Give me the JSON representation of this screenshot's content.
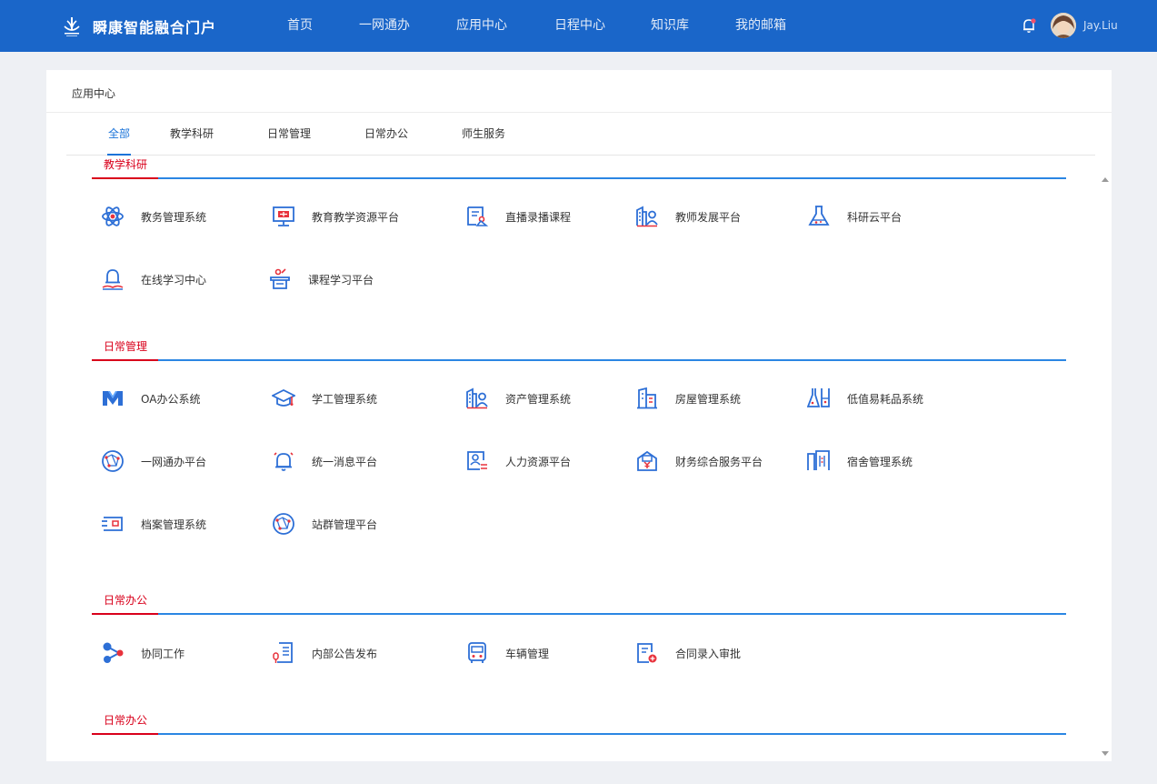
{
  "header": {
    "brand": "瞬康智能融合门户",
    "nav": [
      "首页",
      "一网通办",
      "应用中心",
      "日程中心",
      "知识库",
      "我的邮箱"
    ],
    "username": "Jay.Liu",
    "accent_color": "#1a66c9",
    "icons": {
      "logo": "campus-logo-icon",
      "bell": "bell-icon",
      "avatar": "user-avatar"
    }
  },
  "breadcrumb": "应用中心",
  "tabs": [
    "全部",
    "教学科研",
    "日常管理",
    "日常办公",
    "师生服务"
  ],
  "active_tab": "全部",
  "sections": [
    {
      "title": "教学科研",
      "apps": [
        {
          "name": "教务管理系统",
          "icon": "atom-icon"
        },
        {
          "name": "教育教学资源平台",
          "icon": "monitor-icon"
        },
        {
          "name": "直播录播课程",
          "icon": "broadcast-icon"
        },
        {
          "name": "教师发展平台",
          "icon": "building-person-icon"
        },
        {
          "name": "科研云平台",
          "icon": "flask-icon"
        },
        {
          "name": "在线学习中心",
          "icon": "lamp-book-icon"
        },
        {
          "name": "课程学习平台",
          "icon": "podium-icon"
        }
      ]
    },
    {
      "title": "日常管理",
      "apps": [
        {
          "name": "OA办公系统",
          "icon": "m-logo-icon"
        },
        {
          "name": "学工管理系统",
          "icon": "graduation-cap-icon"
        },
        {
          "name": "资产管理系统",
          "icon": "building-person-icon"
        },
        {
          "name": "房屋管理系统",
          "icon": "house-icon"
        },
        {
          "name": "低值易耗品系统",
          "icon": "beaker-icon"
        },
        {
          "name": "一网通办平台",
          "icon": "network-globe-icon"
        },
        {
          "name": "统一消息平台",
          "icon": "bell-ring-icon"
        },
        {
          "name": "人力资源平台",
          "icon": "id-card-icon"
        },
        {
          "name": "财务综合服务平台",
          "icon": "finance-box-icon"
        },
        {
          "name": "宿舍管理系统",
          "icon": "dormitory-icon"
        },
        {
          "name": "档案管理系统",
          "icon": "archive-icon"
        },
        {
          "name": "站群管理平台",
          "icon": "network-globe-icon"
        }
      ]
    },
    {
      "title": "日常办公",
      "apps": [
        {
          "name": "协同工作",
          "icon": "collaboration-icon"
        },
        {
          "name": "内部公告发布",
          "icon": "scroll-mic-icon"
        },
        {
          "name": "车辆管理",
          "icon": "bus-icon"
        },
        {
          "name": "合同录入审批",
          "icon": "contract-icon"
        }
      ]
    },
    {
      "title": "日常办公",
      "apps": []
    }
  ]
}
